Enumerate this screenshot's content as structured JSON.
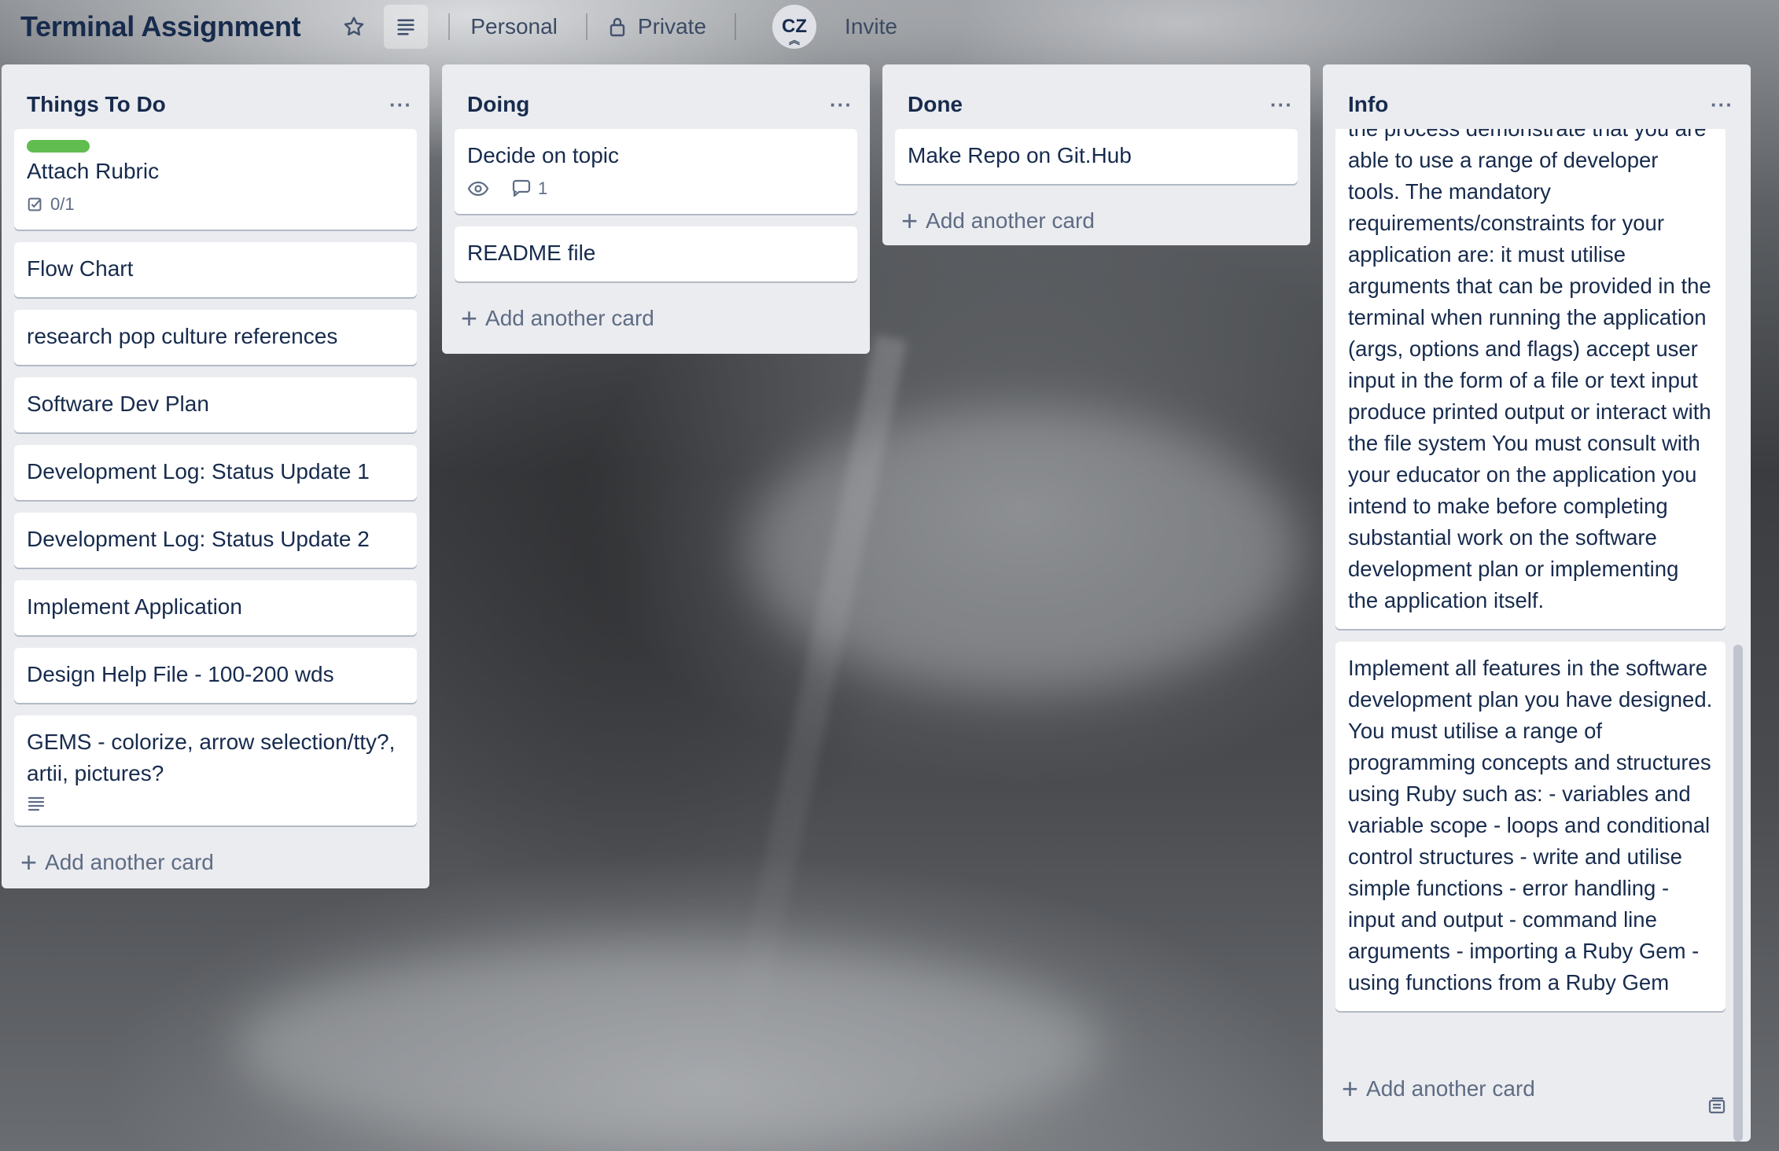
{
  "header": {
    "board_title": "Terminal Assignment",
    "workspace": "Personal",
    "visibility": "Private",
    "member_initials": "CZ",
    "invite_label": "Invite"
  },
  "lists": [
    {
      "title": "Things To Do",
      "menu": "···",
      "cards": [
        {
          "title": "Attach Rubric",
          "label_color": "#61bd4f",
          "checklist": "0/1"
        },
        {
          "title": "Flow Chart"
        },
        {
          "title": "research pop culture references"
        },
        {
          "title": "Software Dev Plan"
        },
        {
          "title": "Development Log: Status Update 1"
        },
        {
          "title": "Development Log: Status Update 2"
        },
        {
          "title": "Implement Application"
        },
        {
          "title": "Design Help File - 100-200 wds"
        },
        {
          "title": "GEMS - colorize, arrow selection/tty?, artii, pictures?",
          "has_description": true
        }
      ],
      "add_label": "Add another card"
    },
    {
      "title": "Doing",
      "menu": "···",
      "cards": [
        {
          "title": "Decide on topic",
          "watching": true,
          "comments": "1"
        },
        {
          "title": "README file"
        }
      ],
      "add_label": "Add another card"
    },
    {
      "title": "Done",
      "menu": "···",
      "cards": [
        {
          "title": "Make Repo on Git.Hub"
        }
      ],
      "add_label": "Add another card"
    },
    {
      "title": "Info",
      "menu": "···",
      "cards": [
        {
          "title": "the process demonstrate that you are able to use a range of developer tools. The mandatory requirements/constraints for your application are: it must utilise arguments that can be provided in the terminal when running the application (args, options and flags) accept user input in the form of a file or text input produce printed output or interact with the file system You must consult with your educator on the application you intend to make before completing substantial work on the software development plan or implementing the application itself."
        },
        {
          "title": "Implement all features in the software development plan you have designed. You must utilise a range of programming concepts and structures using Ruby such as: - variables and variable scope - loops and conditional control structures - write and utilise simple functions - error handling - input and output - command line arguments - importing a Ruby Gem - using functions from a Ruby Gem"
        }
      ],
      "add_label": "Add another card"
    }
  ],
  "icons": {
    "star": "star-icon",
    "board_menu": "list-icon",
    "lock": "lock-icon",
    "checklist": "checklist-icon",
    "watch": "eye-icon",
    "comment": "comment-icon",
    "description": "description-icon",
    "template": "card-template-icon"
  }
}
